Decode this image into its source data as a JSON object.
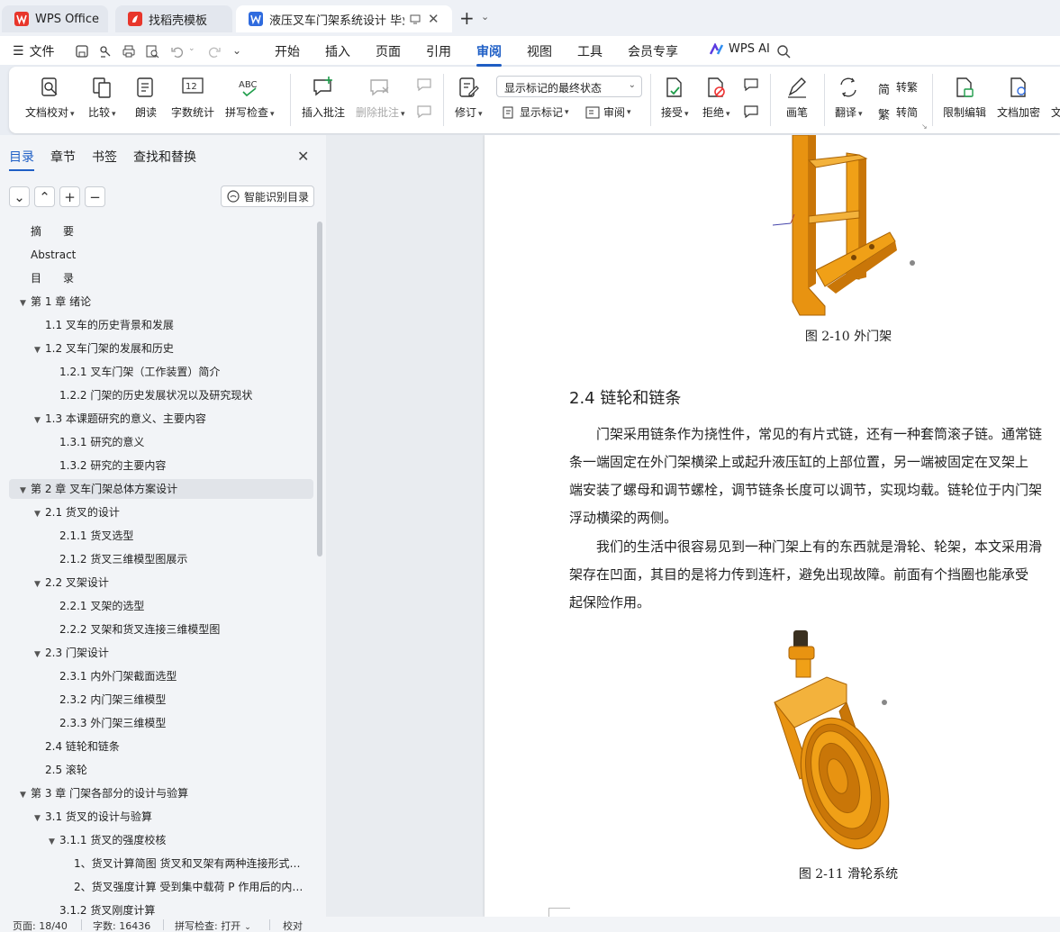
{
  "tabs": [
    {
      "label": "WPS Office"
    },
    {
      "label": "找稻壳模板"
    },
    {
      "label": "液压叉车门架系统设计 毕业论"
    }
  ],
  "menu": {
    "file_label": "文件",
    "items": [
      "开始",
      "插入",
      "页面",
      "引用",
      "审阅",
      "视图",
      "工具",
      "会员专享"
    ],
    "active": "审阅",
    "wps_ai": "WPS AI"
  },
  "ribbon": {
    "proofread": "文档校对",
    "compare": "比较",
    "read_aloud": "朗读",
    "word_count": "字数统计",
    "spell_check": "拼写检查",
    "insert_comment": "插入批注",
    "delete_comment": "删除批注",
    "track_changes": "修订",
    "markup_combo": "显示标记的最终状态",
    "show_markup": "显示标记",
    "review": "审阅",
    "accept": "接受",
    "reject": "拒绝",
    "ink": "画笔",
    "translate": "翻译",
    "to_traditional": "转繁",
    "to_simplified": "转简",
    "restrict_edit": "限制编辑",
    "encrypt": "文档加密",
    "more": "文"
  },
  "nav": {
    "tabs": [
      "目录",
      "章节",
      "书签",
      "查找和替换"
    ],
    "smart_toc": "智能识别目录",
    "items": [
      {
        "label": "摘　　要",
        "level": 1,
        "arrow": ""
      },
      {
        "label": "Abstract",
        "level": 1,
        "arrow": ""
      },
      {
        "label": "目　　录",
        "level": 1,
        "arrow": ""
      },
      {
        "label": "第 1 章  绪论",
        "level": 1,
        "arrow": "▼"
      },
      {
        "label": "1.1  叉车的历史背景和发展",
        "level": 2,
        "arrow": ""
      },
      {
        "label": "1.2  叉车门架的发展和历史",
        "level": 2,
        "arrow": "▼"
      },
      {
        "label": "1.2.1  叉车门架（工作装置）简介",
        "level": 3,
        "arrow": ""
      },
      {
        "label": "1.2.2  门架的历史发展状况以及研究现状",
        "level": 3,
        "arrow": ""
      },
      {
        "label": "1.3  本课题研究的意义、主要内容",
        "level": 2,
        "arrow": "▼"
      },
      {
        "label": "1.3.1  研究的意义",
        "level": 3,
        "arrow": ""
      },
      {
        "label": "1.3.2  研究的主要内容",
        "level": 3,
        "arrow": ""
      },
      {
        "label": "第 2 章  叉车门架总体方案设计",
        "level": 1,
        "arrow": "▼",
        "selected": true
      },
      {
        "label": "2.1  货叉的设计",
        "level": 2,
        "arrow": "▼"
      },
      {
        "label": "2.1.1  货叉选型",
        "level": 3,
        "arrow": ""
      },
      {
        "label": "2.1.2  货叉三维模型图展示",
        "level": 3,
        "arrow": ""
      },
      {
        "label": "2.2  叉架设计",
        "level": 2,
        "arrow": "▼"
      },
      {
        "label": "2.2.1  叉架的选型",
        "level": 3,
        "arrow": ""
      },
      {
        "label": "2.2.2  叉架和货叉连接三维模型图",
        "level": 3,
        "arrow": ""
      },
      {
        "label": "2.3  门架设计",
        "level": 2,
        "arrow": "▼"
      },
      {
        "label": "2.3.1  内外门架截面选型",
        "level": 3,
        "arrow": ""
      },
      {
        "label": "2.3.2  内门架三维模型",
        "level": 3,
        "arrow": ""
      },
      {
        "label": "2.3.3  外门架三维模型",
        "level": 3,
        "arrow": ""
      },
      {
        "label": "2.4  链轮和链条",
        "level": 2,
        "arrow": ""
      },
      {
        "label": "2.5  滚轮",
        "level": 2,
        "arrow": ""
      },
      {
        "label": "第 3 章  门架各部分的设计与验算",
        "level": 1,
        "arrow": "▼"
      },
      {
        "label": "3.1  货叉的设计与验算",
        "level": 2,
        "arrow": "▼"
      },
      {
        "label": "3.1.1  货叉的强度校核",
        "level": 3,
        "arrow": "▼"
      },
      {
        "label": "1、货叉计算简图  货叉和叉架有两种连接形式…",
        "level": 4,
        "arrow": ""
      },
      {
        "label": "2、货叉强度计算  受到集中载荷 P 作用后的内…",
        "level": 4,
        "arrow": ""
      },
      {
        "label": "3.1.2  货叉刚度计算",
        "level": 3,
        "arrow": ""
      }
    ]
  },
  "document": {
    "fig1_caption": "图 2-10 外门架",
    "heading": "2.4  链轮和链条",
    "para1": [
      "　　门架采用链条作为挠性件，常见的有片式链，还有一种套筒滚子链。通常链",
      "条一端固定在外门架横梁上或起升液压缸的上部位置，另一端被固定在叉架上",
      "端安装了螺母和调节螺栓，调节链条长度可以调节，实现均载。链轮位于内门架",
      "浮动横梁的两侧。"
    ],
    "para2": [
      "　　我们的生活中很容易见到一种门架上有的东西就是滑轮、轮架，本文采用滑",
      "架存在凹面，其目的是将力传到连杆，避免出现故障。前面有个挡圈也能承受",
      "起保险作用。"
    ],
    "fig2_caption": "图 2-11 滑轮系统"
  },
  "status": {
    "page": "页面: 18/40",
    "words": "字数: 16436",
    "spell": "拼写检查: 打开",
    "proof": "校对"
  },
  "colors": {
    "accent": "#1f5fc6",
    "model": "#f0a017"
  }
}
